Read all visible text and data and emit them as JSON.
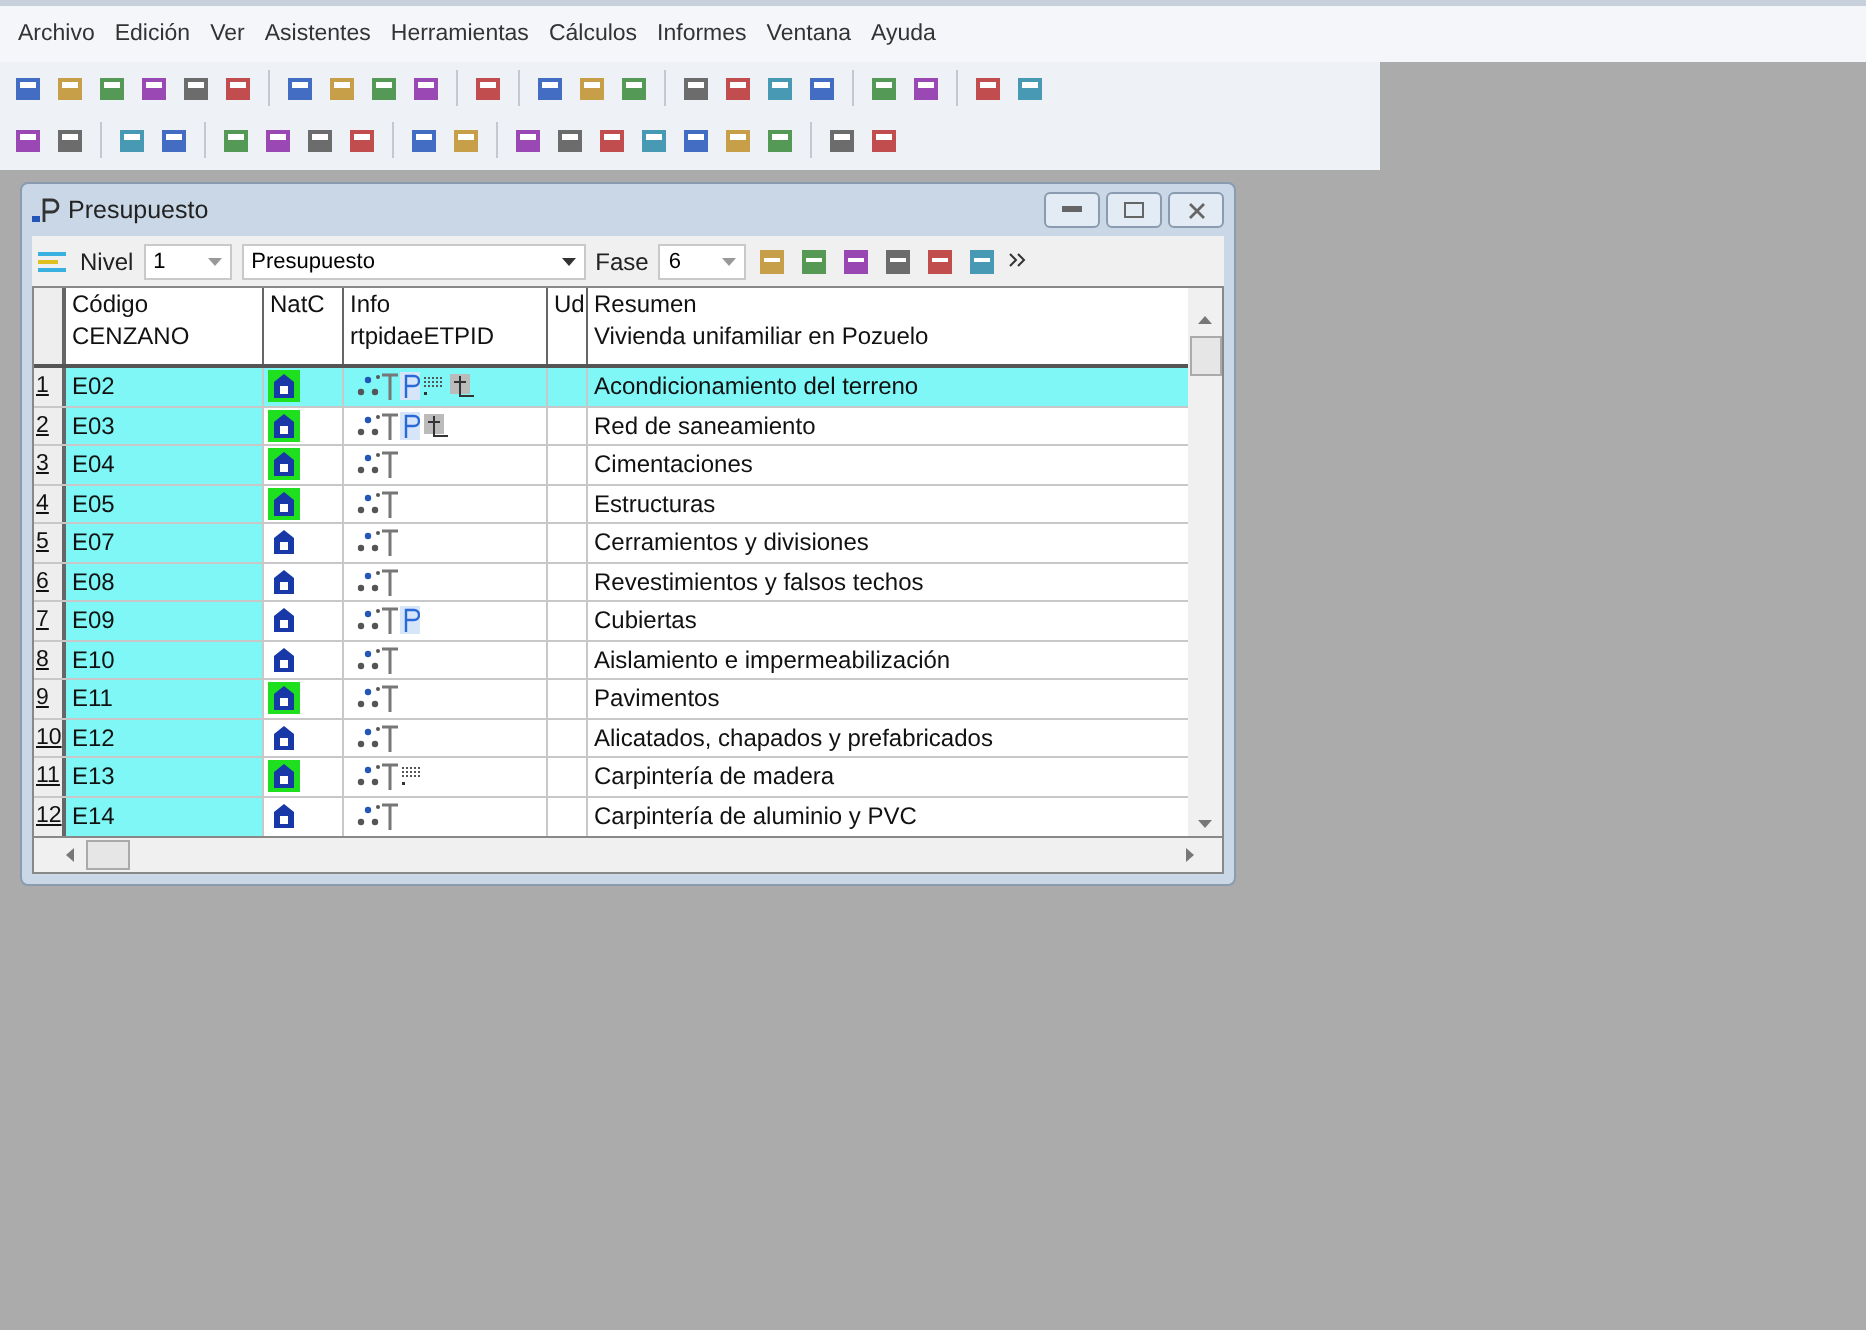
{
  "menu": [
    "Archivo",
    "Edición",
    "Ver",
    "Asistentes",
    "Herramientas",
    "Cálculos",
    "Informes",
    "Ventana",
    "Ayuda"
  ],
  "window": {
    "title": "Presupuesto",
    "toolbar": {
      "level_label": "Nivel",
      "level_value": "1",
      "view_value": "Presupuesto",
      "phase_label": "Fase",
      "phase_value": "6"
    },
    "columns": [
      {
        "line1": "Código",
        "line2": "CENZANO"
      },
      {
        "line1": "NatC"
      },
      {
        "line1": "Info",
        "line2": "rtpidaeETPID"
      },
      {
        "line1": "Ud"
      },
      {
        "line1": "Resumen",
        "line2": "Vivienda unifamiliar en Pozuelo"
      }
    ],
    "rows": [
      {
        "num": "1",
        "code": "E02",
        "natc_highlight": true,
        "p_mark": true,
        "grid_mark": true,
        "ruler_mark": true,
        "summary": "Acondicionamiento del terreno",
        "selected": true
      },
      {
        "num": "2",
        "code": "E03",
        "natc_highlight": true,
        "p_mark": true,
        "grid_mark": false,
        "ruler_mark": true,
        "summary": "Red de saneamiento",
        "selected": false
      },
      {
        "num": "3",
        "code": "E04",
        "natc_highlight": true,
        "p_mark": false,
        "grid_mark": false,
        "ruler_mark": false,
        "summary": "Cimentaciones",
        "selected": false
      },
      {
        "num": "4",
        "code": "E05",
        "natc_highlight": true,
        "p_mark": false,
        "grid_mark": false,
        "ruler_mark": false,
        "summary": "Estructuras",
        "selected": false
      },
      {
        "num": "5",
        "code": "E07",
        "natc_highlight": false,
        "p_mark": false,
        "grid_mark": false,
        "ruler_mark": false,
        "summary": "Cerramientos y divisiones",
        "selected": false
      },
      {
        "num": "6",
        "code": "E08",
        "natc_highlight": false,
        "p_mark": false,
        "grid_mark": false,
        "ruler_mark": false,
        "summary": "Revestimientos y falsos techos",
        "selected": false
      },
      {
        "num": "7",
        "code": "E09",
        "natc_highlight": false,
        "p_mark": true,
        "grid_mark": false,
        "ruler_mark": false,
        "summary": "Cubiertas",
        "selected": false
      },
      {
        "num": "8",
        "code": "E10",
        "natc_highlight": false,
        "p_mark": false,
        "grid_mark": false,
        "ruler_mark": false,
        "summary": "Aislamiento e impermeabilización",
        "selected": false
      },
      {
        "num": "9",
        "code": "E11",
        "natc_highlight": true,
        "p_mark": false,
        "grid_mark": false,
        "ruler_mark": false,
        "summary": "Pavimentos",
        "selected": false
      },
      {
        "num": "10",
        "code": "E12",
        "natc_highlight": false,
        "p_mark": false,
        "grid_mark": false,
        "ruler_mark": false,
        "summary": "Alicatados, chapados y prefabricados",
        "selected": false
      },
      {
        "num": "11",
        "code": "E13",
        "natc_highlight": true,
        "p_mark": false,
        "grid_mark": true,
        "ruler_mark": false,
        "summary": "Carpintería de madera",
        "selected": false
      },
      {
        "num": "12",
        "code": "E14",
        "natc_highlight": false,
        "p_mark": false,
        "grid_mark": false,
        "ruler_mark": false,
        "summary": "Carpintería de aluminio y PVC",
        "selected": false
      }
    ]
  }
}
